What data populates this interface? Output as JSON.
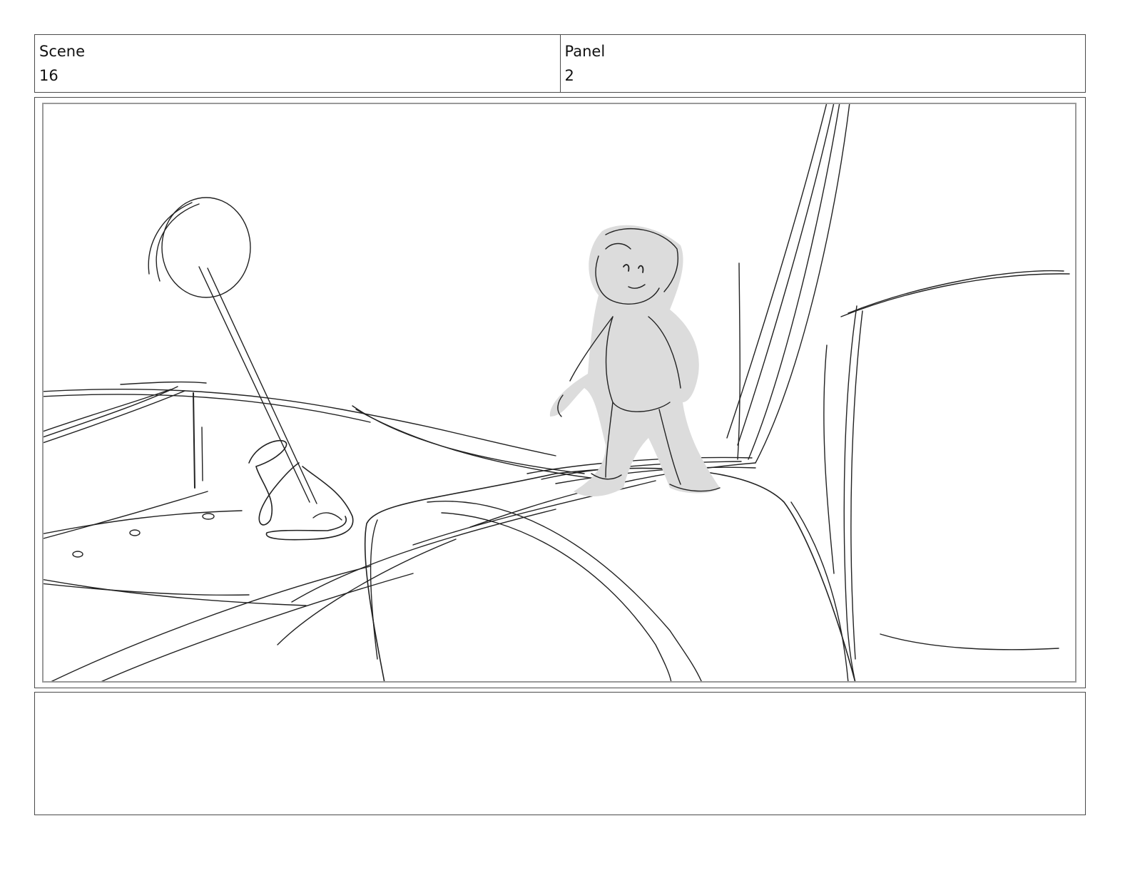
{
  "header": {
    "scene_label": "Scene",
    "scene_value": "16",
    "panel_label": "Panel",
    "panel_value": "2"
  },
  "notes": {
    "text": ""
  },
  "colors": {
    "border": "#4a4a4a",
    "inner_border": "#9a9a9a",
    "sketch_line": "#222222",
    "figure_fill": "#dcdcdc"
  }
}
